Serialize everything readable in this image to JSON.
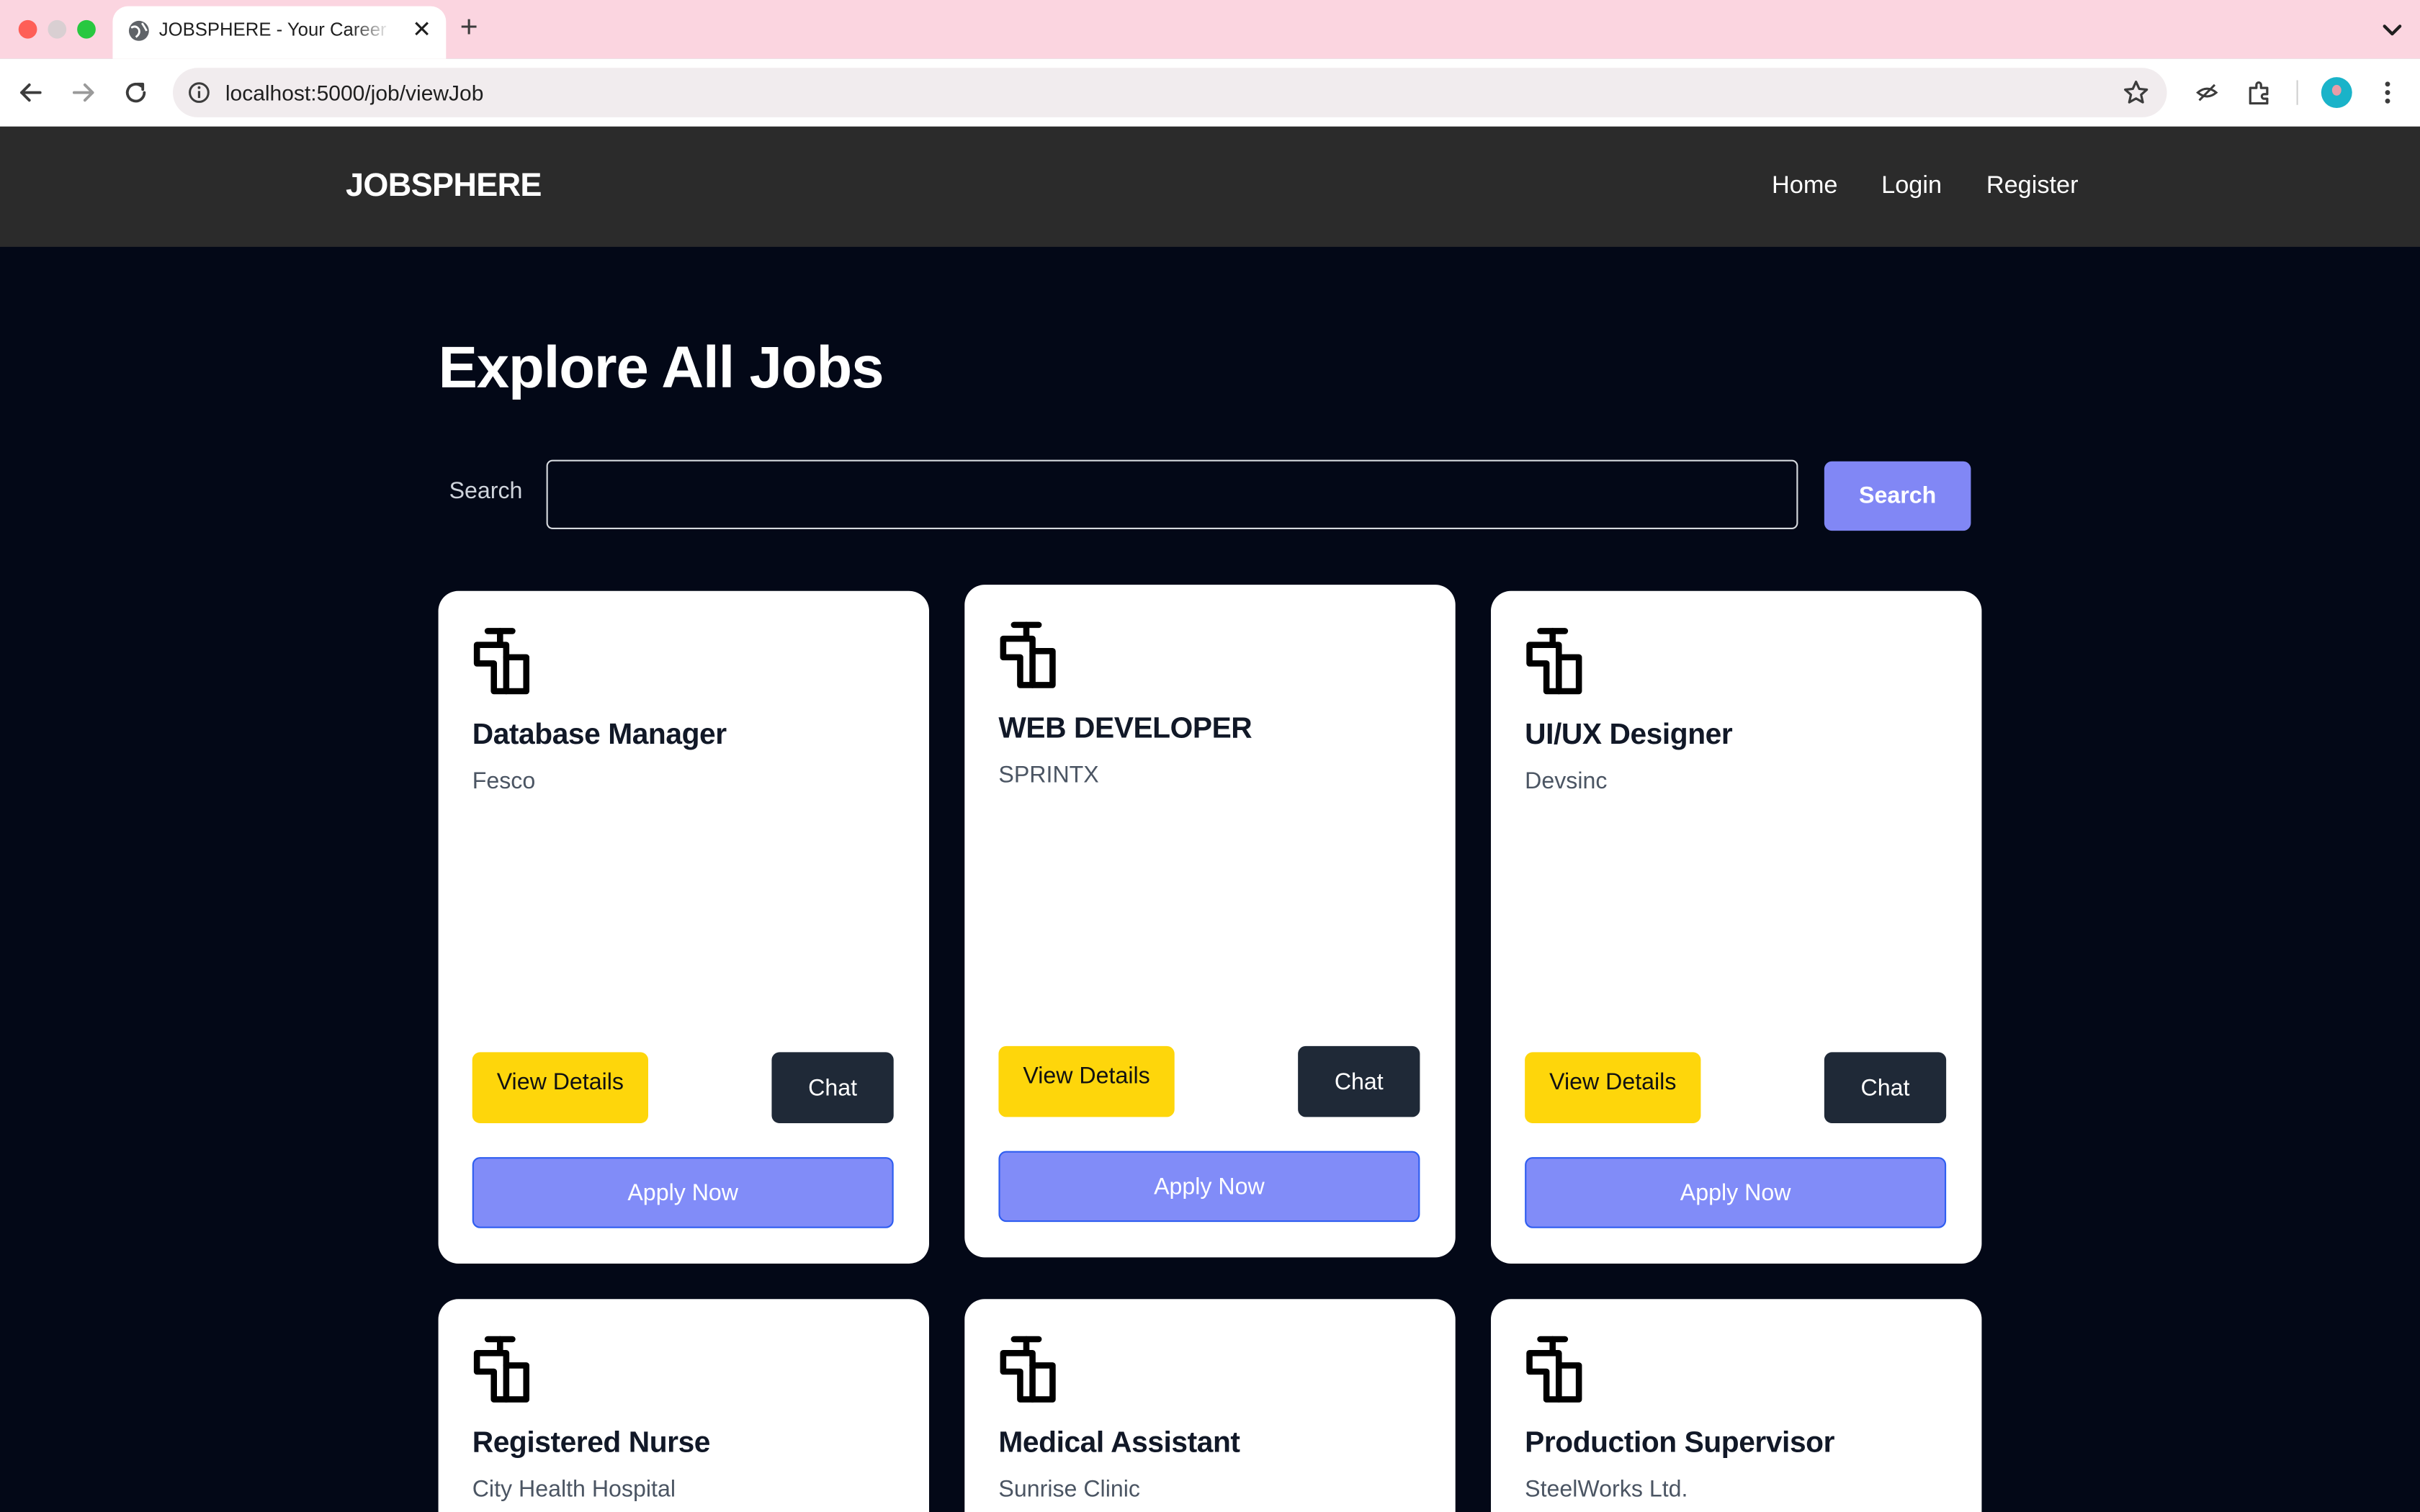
{
  "browser": {
    "tab_title": "JOBSPHERE - Your Career Platform",
    "tab_close": "✕",
    "new_tab": "+",
    "url": "localhost:5000/job/viewJob"
  },
  "site": {
    "logo": "JOBSPHERE",
    "nav": [
      "Home",
      "Login",
      "Register"
    ]
  },
  "main": {
    "title": "Explore All Jobs",
    "search_label": "Search",
    "search_value": "",
    "search_button": "Search"
  },
  "jobs": [
    {
      "title": "Database Manager",
      "company": "Fesco"
    },
    {
      "title": "WEB DEVELOPER",
      "company": "SPRINTX"
    },
    {
      "title": "UI/UX Designer",
      "company": "Devsinc"
    },
    {
      "title": "Registered Nurse",
      "company": "City Health Hospital"
    },
    {
      "title": "Medical Assistant",
      "company": "Sunrise Clinic"
    },
    {
      "title": "Production Supervisor",
      "company": "SteelWorks Ltd."
    }
  ],
  "card_labels": {
    "view_details": "View Details",
    "chat": "Chat",
    "apply": "Apply Now"
  },
  "colors": {
    "page_bg": "#030817",
    "nav_bg": "#2b2b2b",
    "accent": "#818cf8",
    "details_button": "#fed60b",
    "chat_button": "#1f2937"
  }
}
